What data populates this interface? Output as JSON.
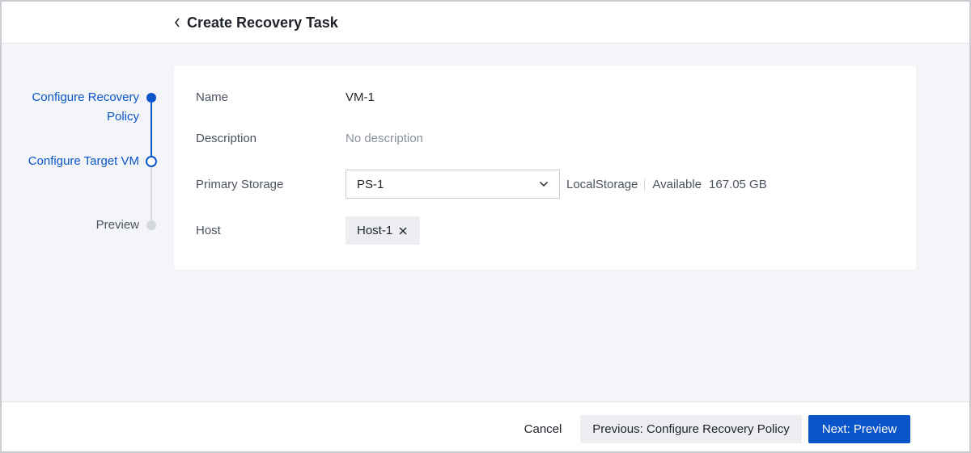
{
  "header": {
    "title": "Create Recovery Task",
    "back_icon": "chevron-left-icon"
  },
  "stepper": {
    "steps": [
      {
        "label_line1": "Configure Recovery",
        "label_line2": "Policy",
        "state": "completed"
      },
      {
        "label": "Configure Target VM",
        "state": "current"
      },
      {
        "label": "Preview",
        "state": "pending"
      }
    ],
    "colors": {
      "active": "#0a55c9",
      "inactive": "#d5d8dc"
    }
  },
  "form": {
    "name": {
      "label": "Name",
      "value": "VM-1"
    },
    "description": {
      "label": "Description",
      "value": "No description"
    },
    "primary_storage": {
      "label": "Primary Storage",
      "value": "PS-1",
      "type": "LocalStorage",
      "available_label": "Available",
      "available_value": "167.05 GB"
    },
    "host": {
      "label": "Host",
      "tag": "Host-1"
    }
  },
  "footer": {
    "cancel_label": "Cancel",
    "previous_label": "Previous: Configure Recovery Policy",
    "next_label": "Next: Preview"
  },
  "colors": {
    "accent": "#0a55c9",
    "background": "#f4f5f8",
    "card": "#ffffff"
  }
}
